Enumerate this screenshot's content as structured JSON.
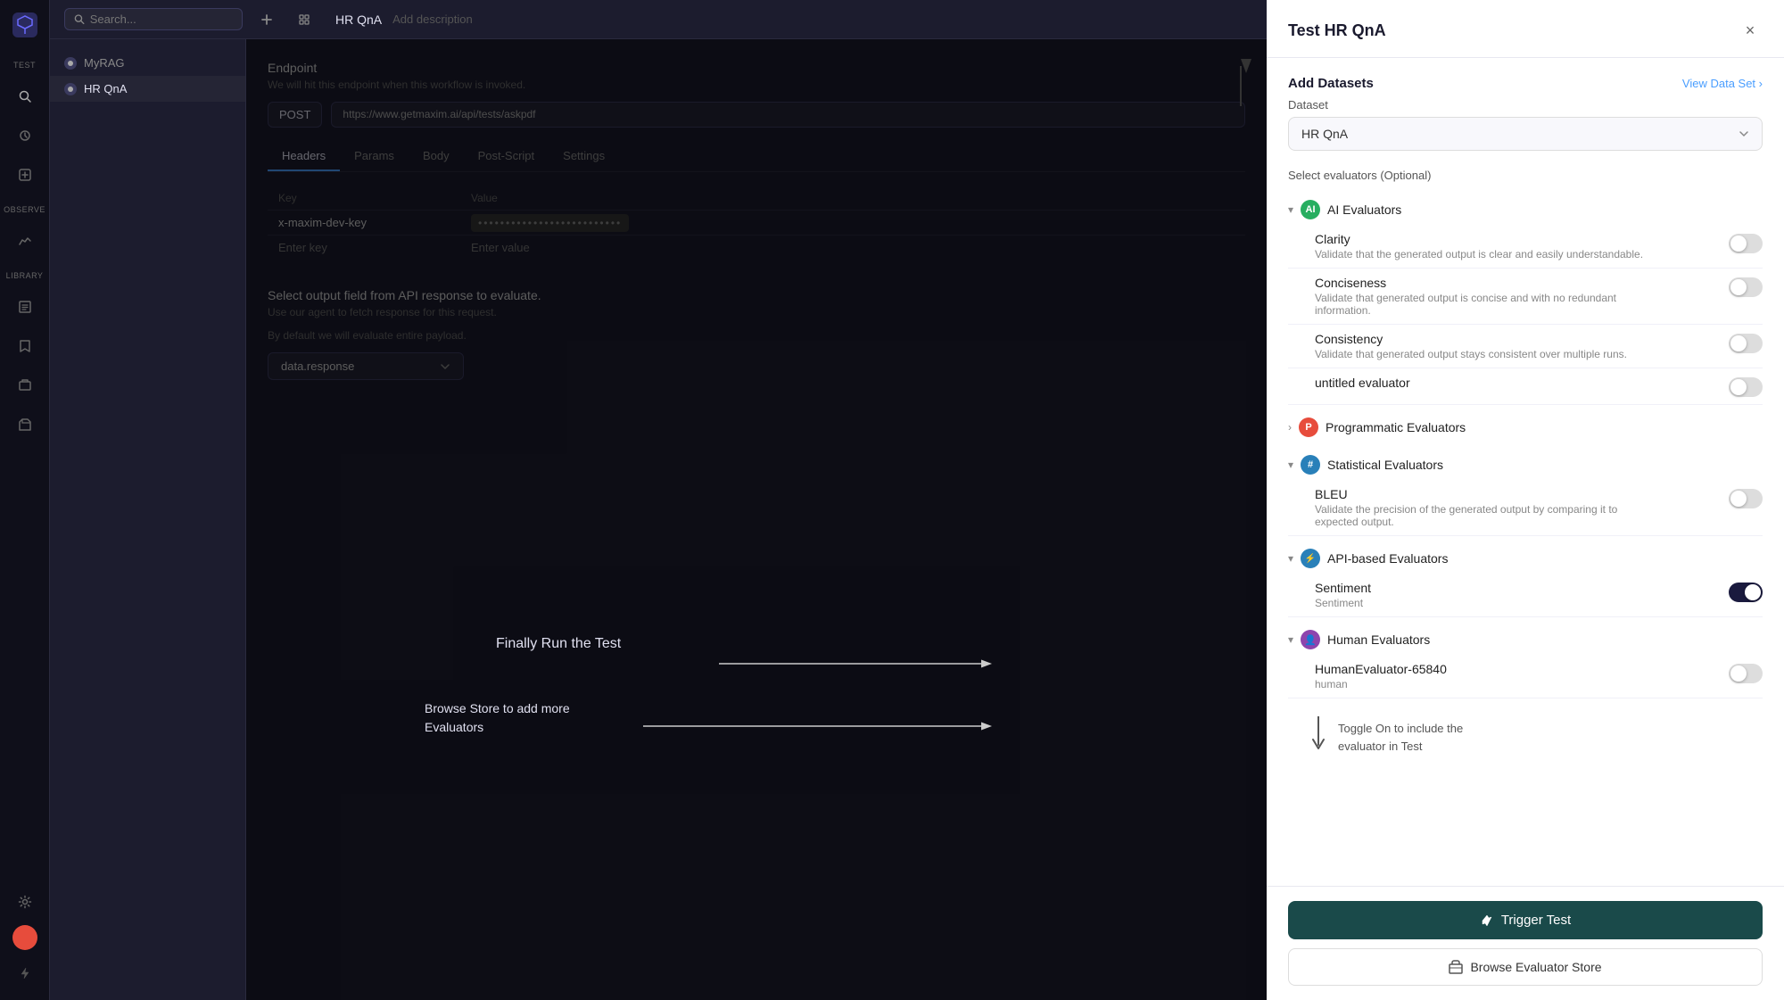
{
  "app": {
    "logo": "✕",
    "sidebar_sections": [
      {
        "id": "test",
        "label": "TEST"
      },
      {
        "id": "observe",
        "label": "OBSERVE"
      },
      {
        "id": "library",
        "label": "LIBRARY"
      }
    ]
  },
  "top_nav": {
    "search_placeholder": "Search...",
    "title": "HR QnA",
    "add_description": "Add description"
  },
  "nav_items": [
    {
      "id": "myrag",
      "label": "MyRAG",
      "dot_color": "default"
    },
    {
      "id": "hrqna",
      "label": "HR QnA",
      "dot_color": "default",
      "active": true
    }
  ],
  "editor": {
    "endpoint_label": "Endpoint",
    "endpoint_sub": "We will hit this endpoint when this workflow is invoked.",
    "method": "POST",
    "url": "https://www.getmaxim.ai/api/tests/askpdf",
    "tabs": [
      "Headers",
      "Params",
      "Body",
      "Post-Script",
      "Settings"
    ],
    "active_tab": "Headers",
    "table_headers": [
      "Key",
      "Value"
    ],
    "key_row": "x-maxim-dev-key",
    "val_row_masked": "••••••••••••••••",
    "enter_key_placeholder": "Enter key",
    "enter_value_placeholder": "Enter value"
  },
  "output_section": {
    "label": "Select output field from API response to evaluate.",
    "sub1": "Use our agent to fetch response for this request.",
    "sub2": "By default we will evaluate entire payload.",
    "field_value": "data.response"
  },
  "annotations": {
    "finally_run": "Finally Run the Test",
    "browse_store": "Browse Store to add more\nEvaluators"
  },
  "right_panel": {
    "title": "Test HR QnA",
    "close_label": "×",
    "add_datasets_heading": "Add Datasets",
    "view_data_link": "View Data Set ›",
    "dataset_label": "Dataset",
    "dataset_value": "HR QnA",
    "evaluators_label": "Select evaluators (Optional)",
    "evaluator_groups": [
      {
        "id": "ai",
        "name": "AI Evaluators",
        "icon": "AI",
        "icon_color": "green",
        "expanded": true,
        "items": [
          {
            "id": "clarity",
            "name": "Clarity",
            "desc": "Validate that the generated output is clear and easily understandable.",
            "on": false
          },
          {
            "id": "conciseness",
            "name": "Conciseness",
            "desc": "Validate that generated output is concise and with no redundant information.",
            "on": false
          },
          {
            "id": "consistency",
            "name": "Consistency",
            "desc": "Validate that generated output stays consistent over multiple runs.",
            "on": false
          },
          {
            "id": "untitled",
            "name": "untitled evaluator",
            "desc": "",
            "on": false
          }
        ]
      },
      {
        "id": "programmatic",
        "name": "Programmatic Evaluators",
        "icon": "P",
        "icon_color": "red",
        "expanded": false,
        "items": []
      },
      {
        "id": "statistical",
        "name": "Statistical Evaluators",
        "icon": "#",
        "icon_color": "blue",
        "expanded": true,
        "items": [
          {
            "id": "bleu",
            "name": "BLEU",
            "desc": "Validate the precision of the generated output by comparing it to expected output.",
            "on": false
          }
        ]
      },
      {
        "id": "api",
        "name": "API-based Evaluators",
        "icon": "A",
        "icon_color": "teal",
        "expanded": true,
        "items": [
          {
            "id": "sentiment",
            "name": "Sentiment",
            "desc": "Sentiment",
            "on": true
          }
        ]
      },
      {
        "id": "human",
        "name": "Human Evaluators",
        "icon": "H",
        "icon_color": "purple",
        "expanded": true,
        "items": [
          {
            "id": "humaneval",
            "name": "HumanEvaluator-65840",
            "desc": "human",
            "on": false
          }
        ]
      }
    ],
    "toggle_tooltip": "Toggle On to include the\nevaluator in Test",
    "trigger_btn_label": "Trigger Test",
    "browse_btn_label": "Browse Evaluator Store"
  }
}
